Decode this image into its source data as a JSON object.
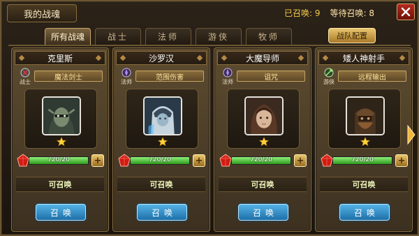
{
  "header": {
    "title": "我的战魂",
    "summoned_label": "已召唤: 9",
    "waiting_label": "等待召唤: 8",
    "close_icon": "close-icon"
  },
  "tabs": [
    {
      "label": "所有战魂",
      "active": true
    },
    {
      "label": "战士",
      "active": false
    },
    {
      "label": "法师",
      "active": false
    },
    {
      "label": "游侠",
      "active": false
    },
    {
      "label": "牧师",
      "active": false
    }
  ],
  "team_button": "战队配置",
  "cards": [
    {
      "name": "克里斯",
      "class_label": "战士",
      "class_icon": "warrior-emblem-icon",
      "skill": "魔法剑士",
      "hp_text": "720/20",
      "hp_fraction": 1.0,
      "stars": 1,
      "status": "可召唤",
      "summon_label": "召唤",
      "portrait_colors": {
        "bg": "#2f3a33",
        "face": "#7a8a70"
      }
    },
    {
      "name": "沙罗汉",
      "class_label": "法师",
      "class_icon": "mage-emblem-icon",
      "skill": "范围伤害",
      "hp_text": "720/20",
      "hp_fraction": 1.0,
      "stars": 1,
      "status": "可召唤",
      "summon_label": "召唤",
      "portrait_colors": {
        "bg": "#2a3a48",
        "face": "#9ab6c8"
      }
    },
    {
      "name": "大魔导师",
      "class_label": "法师",
      "class_icon": "mage-emblem-icon",
      "skill": "诅咒",
      "hp_text": "720/20",
      "hp_fraction": 1.0,
      "stars": 1,
      "status": "可召唤",
      "summon_label": "召唤",
      "portrait_colors": {
        "bg": "#3a2a20",
        "face": "#d9b69a"
      }
    },
    {
      "name": "矮人神射手",
      "class_label": "游侠",
      "class_icon": "ranger-emblem-icon",
      "skill": "远程输出",
      "hp_text": "720/20",
      "hp_fraction": 1.0,
      "stars": 1,
      "status": "可召唤",
      "summon_label": "召唤",
      "portrait_colors": {
        "bg": "#2e2418",
        "face": "#8a5a32"
      }
    }
  ],
  "colors": {
    "accent_gold": "#c8a565",
    "button_blue": "#2e8cc8",
    "hp_green": "#4cc430",
    "star": "#ffd23a"
  },
  "next_icon": "chevron-right-icon"
}
